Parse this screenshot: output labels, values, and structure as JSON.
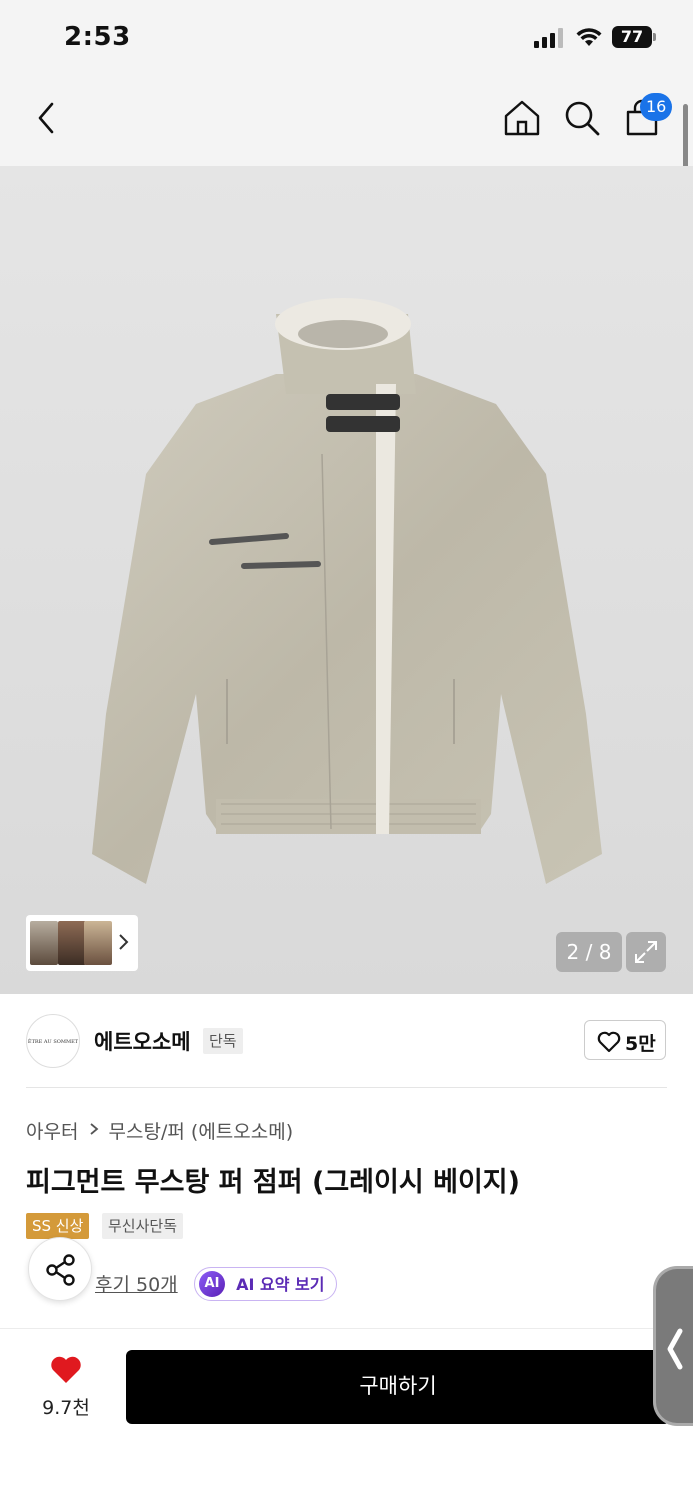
{
  "status_bar": {
    "time": "2:53",
    "battery": "77"
  },
  "nav": {
    "cart_count": "16"
  },
  "gallery": {
    "counter": "2 / 8"
  },
  "brand": {
    "logo_text": "ÊTRE AU SOMMET",
    "name": "에트오소메",
    "tag": "단독",
    "likes": "5만"
  },
  "breadcrumb": {
    "category": "아우터",
    "subcategory": "무스탕/퍼 (에트오소메)"
  },
  "product": {
    "title": "피그먼트 무스탕 퍼 점퍼 (그레이시 베이지)",
    "badges": [
      "SS 신상",
      "무신사단독"
    ],
    "review_label": "후기 50개",
    "ai_chip": "AI",
    "ai_label": "AI 요약 보기"
  },
  "bottom": {
    "wish_count": "9.7천",
    "buy_label": "구매하기"
  },
  "colors": {
    "accent_blue": "#1a73e8",
    "heart_red": "#e0191f",
    "badge_gold": "#d49a3a",
    "ai_purple": "#5b2bb5"
  }
}
